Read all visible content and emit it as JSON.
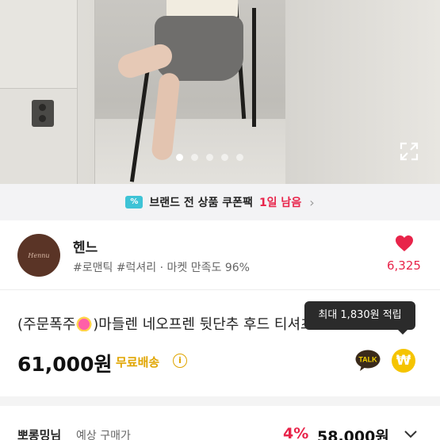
{
  "gallery": {
    "dots_total": 5,
    "active_index": 0,
    "expand_icon": "expand-icon"
  },
  "coupon_bar": {
    "icon": "coupon-percent-icon",
    "icon_glyph": "%",
    "text": "브랜드 전 상품 쿠폰팩",
    "days_left": "1일 남음",
    "chevron": "›"
  },
  "seller": {
    "avatar_text": "Hennu",
    "name": "헨느",
    "tags": "#로맨틱 #럭셔리 · 마켓 만족도 96%",
    "likes": "6,325",
    "heart_color": "#e8244a"
  },
  "product": {
    "title_prefix": "(주문폭주",
    "title_suffix": ")마들렌 네오프렌 뒷단추 후드 티셔츠",
    "price": "61,000원",
    "shipping": "무료배송",
    "info_icon": "i",
    "points_tooltip": "최대 1,830원 적립",
    "talk_label": "TALK",
    "won_symbol": "₩"
  },
  "bottom_bar": {
    "seller": "뽀롱밍님",
    "label": "예상 구매가",
    "discount": "4%",
    "final_price": "58,000원"
  },
  "colors": {
    "accent_red": "#e8244a",
    "shipping_yellow": "#e0a500",
    "point_yellow": "#f5c400",
    "coupon_teal": "#3ec3d6"
  }
}
